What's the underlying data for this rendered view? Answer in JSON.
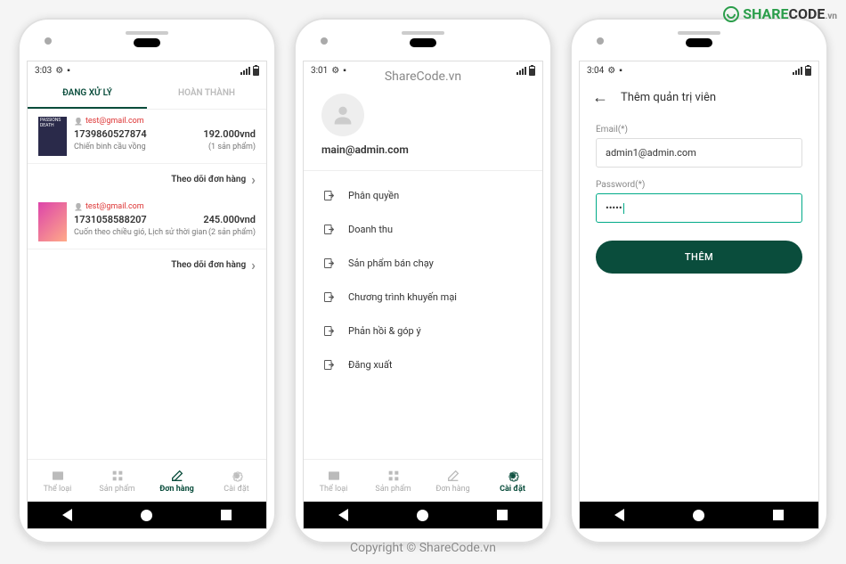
{
  "watermarks": {
    "top": "ShareCode.vn",
    "bottom": "Copyright © ShareCode.vn",
    "logo_green": "SHARE",
    "logo_black": "CODE",
    "logo_suffix": ".vn"
  },
  "statusBar": {
    "t1": "3:03",
    "t2": "3:01",
    "t3": "3:04"
  },
  "screen1": {
    "tabs": [
      {
        "label": "ĐANG XỬ LÝ",
        "active": true
      },
      {
        "label": "HOÀN THÀNH",
        "active": false
      }
    ],
    "orders": [
      {
        "email": "test@gmail.com",
        "id": "1739860527874",
        "price": "192.000vnd",
        "desc": "Chiến binh cầu vồng",
        "qty": "(1 sản phẩm)",
        "thumb": "PASSIONS DEATH",
        "thumbClass": "thumb"
      },
      {
        "email": "test@gmail.com",
        "id": "1731058588207",
        "price": "245.000vnd",
        "desc": "Cuốn theo chiều gió, Lịch sử thời gian",
        "qty": "(2 sản phẩm)",
        "thumb": "",
        "thumbClass": "thumb thumb2"
      }
    ],
    "track": "Theo dõi đơn hàng"
  },
  "screen2": {
    "email": "main@admin.com",
    "items": [
      "Phân quyền",
      "Doanh thu",
      "Sản phẩm bán chạy",
      "Chương trình khuyến mại",
      "Phản hồi & góp ý",
      "Đăng xuất"
    ]
  },
  "screen3": {
    "title": "Thêm quản trị viên",
    "emailLabel": "Email(*)",
    "emailValue": "admin1@admin.com",
    "pwLabel": "Password(*)",
    "pwValue": "•••••",
    "submit": "THÊM"
  },
  "nav": {
    "items": [
      {
        "label": "Thể loại",
        "icon": "category"
      },
      {
        "label": "Sản phẩm",
        "icon": "grid"
      },
      {
        "label": "Đơn hàng",
        "icon": "edit"
      },
      {
        "label": "Cài đặt",
        "icon": "gear"
      }
    ],
    "active1": 2,
    "active2": 3
  }
}
